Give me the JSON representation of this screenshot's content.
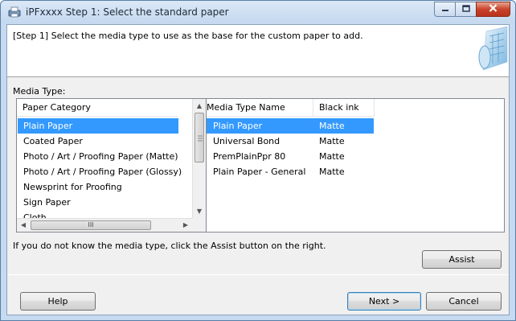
{
  "window": {
    "title": "iPFxxxx Step 1: Select the standard paper",
    "colors": {
      "selection": "#3399ff",
      "close_button": "#c8432a"
    }
  },
  "header": {
    "instruction": "[Step 1] Select the media type to use as the base for the custom paper to add."
  },
  "media_type_label": "Media Type:",
  "category_list": {
    "header": "Paper Category",
    "selected_index": 0,
    "items": [
      "Plain Paper",
      "Coated Paper",
      "Photo / Art / Proofing Paper (Matte)",
      "Photo / Art / Proofing Paper (Glossy)",
      "Newsprint for Proofing",
      "Sign Paper",
      "Cloth"
    ],
    "scroll_thumb_glyph": "III"
  },
  "media_list": {
    "columns": [
      "Media Type Name",
      "Black ink"
    ],
    "selected_index": 0,
    "rows": [
      {
        "name": "Plain Paper",
        "ink": "Matte"
      },
      {
        "name": "Universal Bond",
        "ink": "Matte"
      },
      {
        "name": "PremPlainPpr 80",
        "ink": "Matte"
      },
      {
        "name": "Plain Paper - General",
        "ink": "Matte"
      }
    ]
  },
  "hint": "If you do not know the media type, click the Assist button on the right.",
  "buttons": {
    "assist": "Assist",
    "help": "Help",
    "next": "Next >",
    "cancel": "Cancel"
  },
  "icons": {
    "title": "printer-app-icon",
    "header_art": "paper-roll-graphic",
    "minimize": "minimize-icon",
    "maximize": "maximize-icon",
    "close": "close-icon"
  }
}
